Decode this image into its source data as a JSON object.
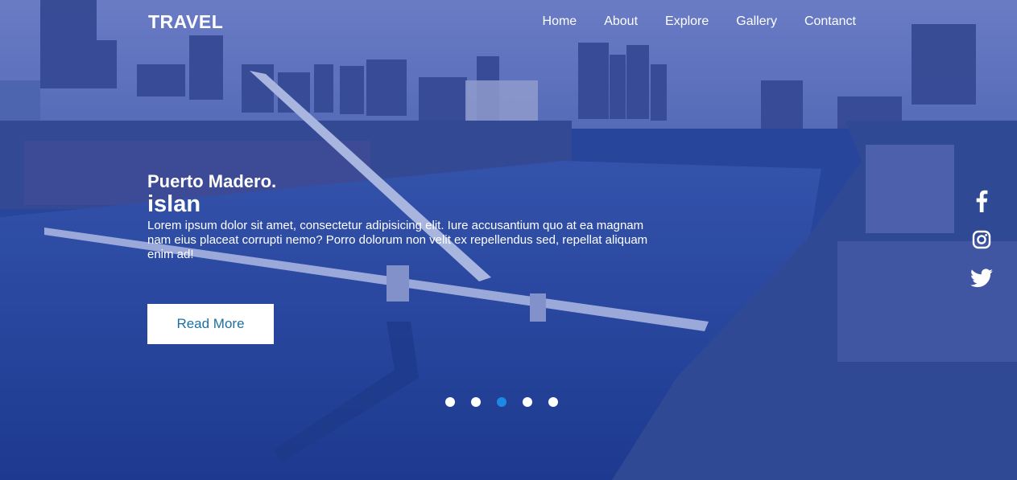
{
  "brand": {
    "logo": "TRAVEL"
  },
  "nav": {
    "items": [
      "Home",
      "About",
      "Explore",
      "Gallery",
      "Contanct"
    ]
  },
  "hero": {
    "subtitle": "Puerto Madero.",
    "title": "islan",
    "description": "Lorem ipsum dolor sit amet, consectetur adipisicing elit. Iure accusantium quo at ea magnam nam eius placeat corrupti nemo? Porro dolorum non velit ex repellendus sed, repellat aliquam enim ad!",
    "button_label": "Read More"
  },
  "slider": {
    "count": 5,
    "active_index": 2
  },
  "social": {
    "icons": [
      "facebook-icon",
      "instagram-icon",
      "twitter-icon"
    ]
  },
  "colors": {
    "accent": "#1e88e5",
    "button_text": "#1d6fa3",
    "overlay": "#2a4a8c"
  }
}
